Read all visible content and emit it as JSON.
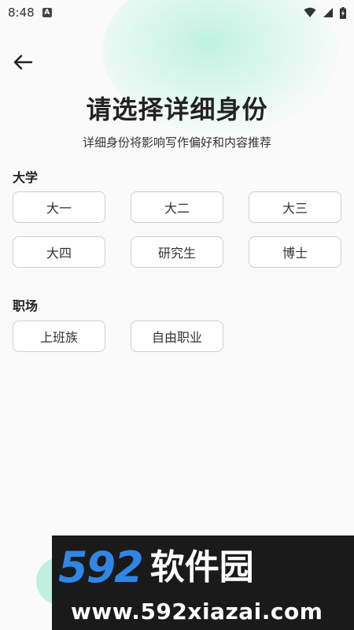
{
  "status_bar": {
    "time": "8:48",
    "notif_letter": "A"
  },
  "header": {
    "title": "请选择详细身份",
    "subtitle": "详细身份将影响写作偏好和内容推荐"
  },
  "sections": {
    "university": {
      "title": "大学",
      "options": [
        "大一",
        "大二",
        "大三",
        "大四",
        "研究生",
        "博士"
      ]
    },
    "workplace": {
      "title": "职场",
      "options": [
        "上班族",
        "自由职业"
      ]
    }
  },
  "watermark": {
    "brand_number": "592",
    "brand_name": "软件园",
    "url": "www.592xiazai.com"
  },
  "colors": {
    "chip_border": "#cfcfcf",
    "accent_glow": "#bff0dd",
    "watermark_blue": "#2f86e6"
  }
}
